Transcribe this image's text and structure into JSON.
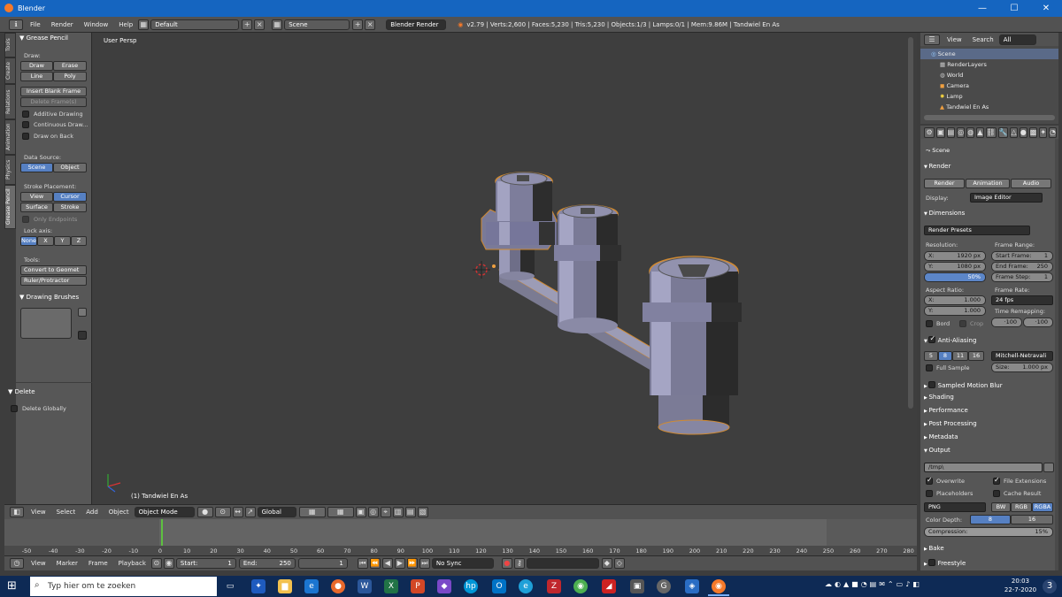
{
  "window": {
    "title": "Blender",
    "minimize": "—",
    "maximize": "☐",
    "close": "✕"
  },
  "infobar": {
    "menus": [
      "File",
      "Render",
      "Window",
      "Help"
    ],
    "layout": "Default",
    "scene": "Scene",
    "engine": "Blender Render",
    "stats": "v2.79 | Verts:2,600 | Faces:5,230 | Tris:5,230 | Objects:1/3 | Lamps:0/1 | Mem:9.86M | Tandwiel En As"
  },
  "tabs": [
    "Tools",
    "Create",
    "Relations",
    "Animation",
    "Physics",
    "Grease Pencil"
  ],
  "shelf": {
    "panel_title": "Grease Pencil",
    "draw_label": "Draw:",
    "draw": "Draw",
    "erase": "Erase",
    "line": "Line",
    "poly": "Poly",
    "insert_blank": "Insert Blank Frame",
    "delete_frames": "Delete Frame(s)",
    "additive": "Additive Drawing",
    "continuous": "Continuous Draw...",
    "draw_on_back": "Draw on Back",
    "data_source_label": "Data Source:",
    "scene_btn": "Scene",
    "object_btn": "Object",
    "stroke_placement_label": "Stroke Placement:",
    "view_btn": "View",
    "cursor_btn": "Cursor",
    "surface_btn": "Surface",
    "stroke_btn": "Stroke",
    "only_endpoints": "Only Endpoints",
    "lock_axis_label": "Lock axis:",
    "axes": [
      "None",
      "X",
      "Y",
      "Z"
    ],
    "tools_label": "Tools:",
    "convert": "Convert to Geomet",
    "ruler": "Ruler/Protractor",
    "brushes_title": "Drawing Brushes",
    "delete_title": "Delete",
    "delete_globally": "Delete Globally"
  },
  "viewport": {
    "view_name": "User Persp",
    "object_label": "(1) Tandwiel En As"
  },
  "vpheader": {
    "menus": [
      "View",
      "Select",
      "Add",
      "Object"
    ],
    "mode": "Object Mode",
    "orientation": "Global"
  },
  "timeline": {
    "ticks": [
      "-50",
      "-40",
      "-30",
      "-20",
      "-10",
      "0",
      "10",
      "20",
      "30",
      "40",
      "50",
      "60",
      "70",
      "80",
      "90",
      "100",
      "110",
      "120",
      "130",
      "140",
      "150",
      "160",
      "170",
      "180",
      "190",
      "200",
      "210",
      "220",
      "230",
      "240",
      "250",
      "260",
      "270",
      "280"
    ],
    "menus": [
      "View",
      "Marker",
      "Frame",
      "Playback"
    ],
    "start_label": "Start:",
    "start": "1",
    "end_label": "End:",
    "end": "250",
    "current": "1",
    "sync": "No Sync"
  },
  "outliner": {
    "view": "View",
    "search": "Search",
    "filter": "All Scenes",
    "rows": [
      "Scene",
      "RenderLayers",
      "World",
      "Camera",
      "Lamp",
      "Tandwiel En As"
    ]
  },
  "props": {
    "scene": "Scene",
    "render_section": "Render",
    "render_btn": "Render",
    "animation_btn": "Animation",
    "audio_btn": "Audio",
    "display_label": "Display:",
    "display": "Image Editor",
    "dimensions_section": "Dimensions",
    "presets": "Render Presets",
    "resolution_label": "Resolution:",
    "res_x_label": "X:",
    "res_x": "1920 px",
    "res_y_label": "Y:",
    "res_y": "1080 px",
    "res_pct": "50%",
    "frame_range_label": "Frame Range:",
    "start_frame_label": "Start Frame:",
    "start_frame": "1",
    "end_frame_label": "End Frame:",
    "end_frame": "250",
    "frame_step_label": "Frame Step:",
    "frame_step": "1",
    "aspect_label": "Aspect Ratio:",
    "asp_x_label": "X:",
    "asp_x": "1.000",
    "asp_y_label": "Y:",
    "asp_y": "1.000",
    "frame_rate_label": "Frame Rate:",
    "fps": "24 fps",
    "time_remap_label": "Time Remapping:",
    "remap_old": "·100",
    "remap_new": "·100",
    "bord": "Bord",
    "crop": "Crop",
    "aa_section": "Anti-Aliasing",
    "aa_samples": [
      "5",
      "8",
      "11",
      "16"
    ],
    "aa_filter": "Mitchell-Netravali",
    "full_sample": "Full Sample",
    "size_label": "Size:",
    "size": "1.000 px",
    "motion_blur": "Sampled Motion Blur",
    "shading": "Shading",
    "performance": "Performance",
    "post_processing": "Post Processing",
    "metadata": "Metadata",
    "output_section": "Output",
    "output_path": "/tmp\\",
    "overwrite": "Overwrite",
    "file_extensions": "File Extensions",
    "placeholders": "Placeholders",
    "cache_result": "Cache Result",
    "format": "PNG",
    "bw": "BW",
    "rgb": "RGB",
    "rgba": "RGBA",
    "color_depth_label": "Color Depth:",
    "depth_8": "8",
    "depth_16": "16",
    "compression_label": "Compression:",
    "compression": "15%",
    "bake": "Bake",
    "freestyle": "Freestyle"
  },
  "taskbar": {
    "search_placeholder": "Typ hier om te zoeken",
    "time": "20:03",
    "date": "22-7-2020"
  },
  "colors": {
    "accent_blue": "#5680c2",
    "selected_orange": "#f0a040",
    "taskbar": "#0e2a55"
  }
}
